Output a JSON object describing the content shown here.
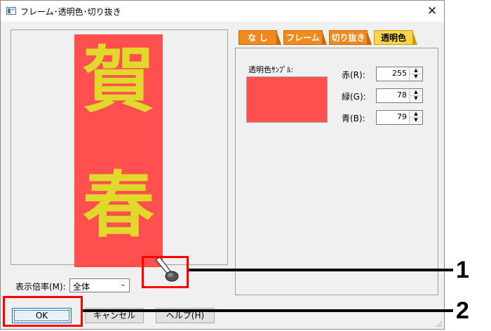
{
  "window": {
    "title": "フレーム･透明色･切り抜き",
    "close_glyph": "✕"
  },
  "preview": {
    "kanji_top": "賀",
    "kanji_bottom": "春",
    "card_color": "#ff4f4f",
    "text_color": "#e0d82a"
  },
  "zoom": {
    "label": "表示倍率(M):",
    "value": "全体"
  },
  "tabs": [
    {
      "label": "な し",
      "active": false
    },
    {
      "label": "フレーム",
      "active": false
    },
    {
      "label": "切り抜き",
      "active": false
    },
    {
      "label": "透明色",
      "active": true
    }
  ],
  "transparent": {
    "sample_label": "透明色ｻﾝﾌﾟﾙ:",
    "sample_color": "#ff4f4f",
    "red_label": "赤(R):",
    "red_value": "255",
    "green_label": "緑(G):",
    "green_value": "78",
    "blue_label": "青(B):",
    "blue_value": "79"
  },
  "buttons": {
    "ok": "OK",
    "cancel": "キャンセル",
    "help": "ヘルプ(H)"
  },
  "annotations": {
    "n1": "1",
    "n2": "2"
  }
}
